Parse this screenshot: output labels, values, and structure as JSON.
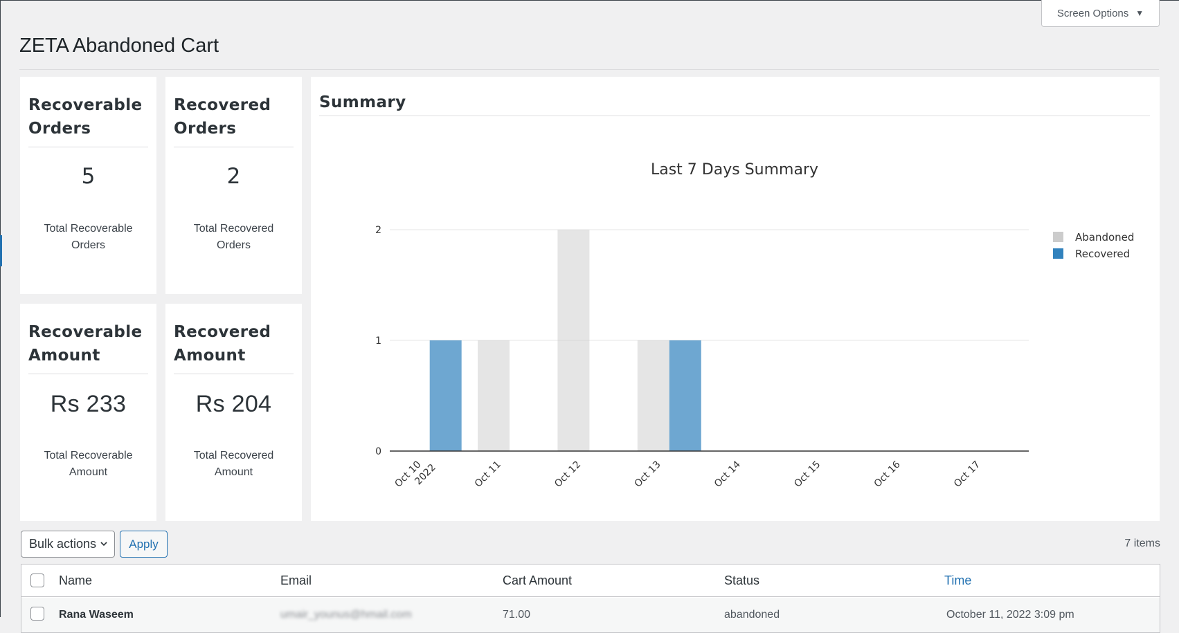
{
  "screen_options": {
    "label": "Screen Options"
  },
  "page": {
    "title": "ZETA Abandoned Cart"
  },
  "cards": [
    {
      "title": "Recoverable Orders",
      "value": "5",
      "caption": "Total Recoverable Orders"
    },
    {
      "title": "Recovered Orders",
      "value": "2",
      "caption": "Total Recovered Orders"
    },
    {
      "title": "Recoverable Amount",
      "value": "Rs 233",
      "caption": "Total Recoverable Amount"
    },
    {
      "title": "Recovered Amount",
      "value": "Rs 204",
      "caption": "Total Recovered Amount"
    }
  ],
  "summary": {
    "title": "Summary"
  },
  "chart_data": {
    "type": "bar",
    "title": "Last 7 Days Summary",
    "categories": [
      "Oct 10\n2022",
      "Oct 11",
      "Oct 12",
      "Oct 13",
      "Oct 14",
      "Oct 15",
      "Oct 16",
      "Oct 17"
    ],
    "series": [
      {
        "name": "Abandoned",
        "color": "#cccccc",
        "values": [
          0,
          1,
          2,
          1,
          0,
          0,
          0,
          0
        ]
      },
      {
        "name": "Recovered",
        "color": "#3182bd",
        "values": [
          1,
          0,
          0,
          1,
          0,
          0,
          0,
          0
        ]
      }
    ],
    "ylim": [
      0,
      2
    ],
    "yticks": [
      "0",
      "1",
      "2"
    ],
    "grid": true,
    "legend": "right"
  },
  "tablenav": {
    "bulk_label": "Bulk actions",
    "apply_label": "Apply",
    "items_count": "7 items"
  },
  "table": {
    "columns": [
      "Name",
      "Email",
      "Cart Amount",
      "Status",
      "Time"
    ],
    "rows": [
      {
        "name": "Rana Waseem",
        "email": "umair_younus@hmail.com",
        "amount": "71.00",
        "status": "abandoned",
        "time": "October 11, 2022 3:09 pm"
      }
    ]
  }
}
